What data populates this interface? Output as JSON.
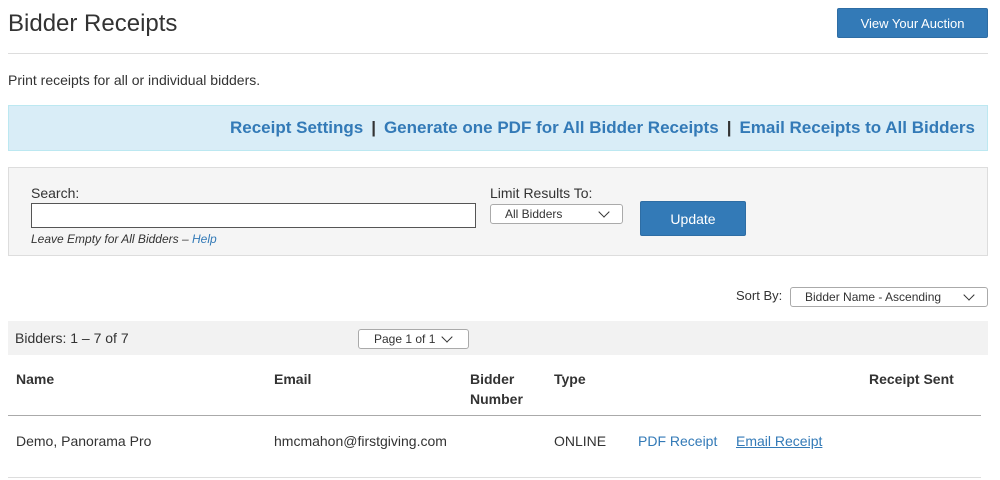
{
  "header": {
    "title": "Bidder Receipts",
    "view_auction_label": "View Your Auction",
    "subtitle": "Print receipts for all or individual bidders."
  },
  "actions": {
    "receipt_settings": "Receipt Settings",
    "separator": "|",
    "generate_pdf": "Generate one PDF for All Bidder Receipts",
    "email_all": "Email Receipts to All Bidders"
  },
  "search": {
    "label": "Search:",
    "value": "",
    "hint": "Leave Empty for All Bidders –",
    "help_label": "Help",
    "limit_label": "Limit Results To:",
    "limit_selected": "All Bidders",
    "update_label": "Update"
  },
  "sort": {
    "label": "Sort By:",
    "selected": "Bidder Name - Ascending"
  },
  "pager": {
    "count_text": "Bidders: 1 – 7 of 7",
    "page_selected": "Page 1 of 1"
  },
  "table": {
    "columns": {
      "name": "Name",
      "email": "Email",
      "bidder_number_line1": "Bidder",
      "bidder_number_line2": "Number",
      "type": "Type",
      "receipt_sent": "Receipt Sent"
    },
    "rows": [
      {
        "name": "Demo, Panorama Pro",
        "email": "hmcmahon@firstgiving.com",
        "bidder_number": "",
        "type": "ONLINE",
        "pdf_receipt": "PDF Receipt",
        "email_receipt": "Email Receipt",
        "receipt_sent": ""
      }
    ]
  },
  "colors": {
    "primary": "#337ab7",
    "info_bg": "#d9edf7",
    "panel_bg": "#f5f5f5"
  }
}
